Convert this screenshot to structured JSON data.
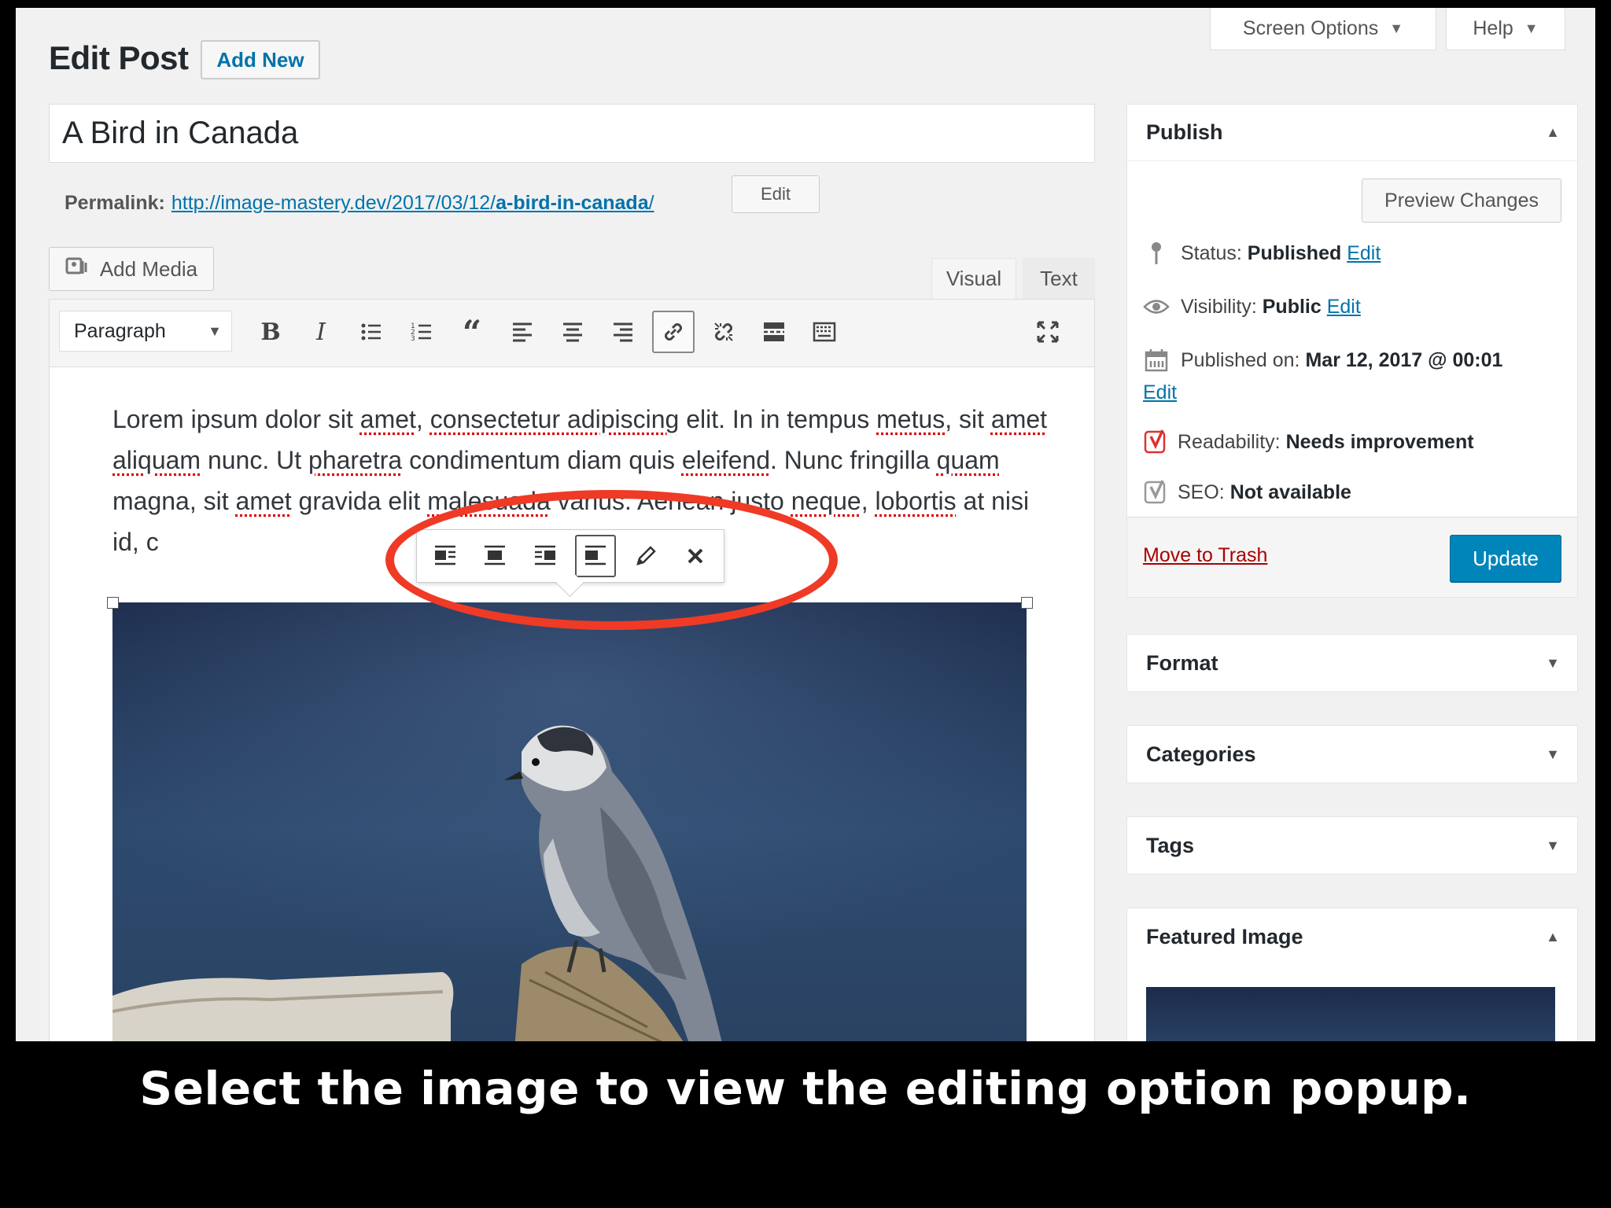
{
  "header": {
    "page_title": "Edit Post",
    "add_new_label": "Add New",
    "screen_options_label": "Screen Options",
    "help_label": "Help"
  },
  "post": {
    "title": "A Bird in Canada",
    "permalink_label": "Permalink:",
    "permalink_base": "http://image-mastery.dev/2017/03/12/",
    "permalink_slug": "a-bird-in-canada",
    "permalink_end": "/",
    "permalink_edit_label": "Edit"
  },
  "editor": {
    "add_media_label": "Add Media",
    "tabs": {
      "visual": "Visual",
      "text": "Text"
    },
    "format_select_value": "Paragraph",
    "toolbar_buttons": [
      "bold",
      "italic",
      "bulleted-list",
      "numbered-list",
      "blockquote",
      "align-left",
      "align-center",
      "align-right",
      "insert-link",
      "remove-link",
      "read-more",
      "toolbar-toggle",
      "fullscreen"
    ],
    "content_text": {
      "w1": "Lorem ipsum dolor sit ",
      "s1": "amet",
      "w2": ", ",
      "s2": "consectetur adipiscing",
      "w3": " elit. In in tempus ",
      "s3": "metus",
      "w4": ", sit ",
      "s4": "amet aliquam",
      "w5": " nunc. Ut ",
      "s5": "pharetra",
      "w6": " condimentum diam quis ",
      "s6": "eleifend",
      "w7": ". Nunc fringilla ",
      "s7": "quam",
      "w8": " magna, sit ",
      "s8": "amet",
      "w9": " gravida elit ",
      "s9": "malesuada",
      "w10": " varius. Aenean justo ",
      "s10": "neque",
      "w11": ", ",
      "s11": "lobortis",
      "w12": " at nisi id, c"
    },
    "image_popup_buttons": [
      "align-left",
      "align-center",
      "align-right",
      "align-none",
      "edit-image",
      "remove-image"
    ]
  },
  "sidebar": {
    "publish": {
      "title": "Publish",
      "preview_label": "Preview Changes",
      "status_label": "Status:",
      "status_value": "Published",
      "visibility_label": "Visibility:",
      "visibility_value": "Public",
      "published_on_label": "Published on:",
      "published_on_value": "Mar 12, 2017 @ 00:01",
      "readability_label": "Readability:",
      "readability_value": "Needs improvement",
      "seo_label": "SEO:",
      "seo_value": "Not available",
      "edit_link": "Edit",
      "trash_label": "Move to Trash",
      "update_label": "Update"
    },
    "boxes": {
      "format": "Format",
      "categories": "Categories",
      "tags": "Tags",
      "featured_image": "Featured Image"
    }
  },
  "caption": "Select the image to view the editing option popup.",
  "colors": {
    "link": "#0073aa",
    "update_button": "#0085ba",
    "highlight_ring": "#ef3a26",
    "trash": "#a00000"
  }
}
